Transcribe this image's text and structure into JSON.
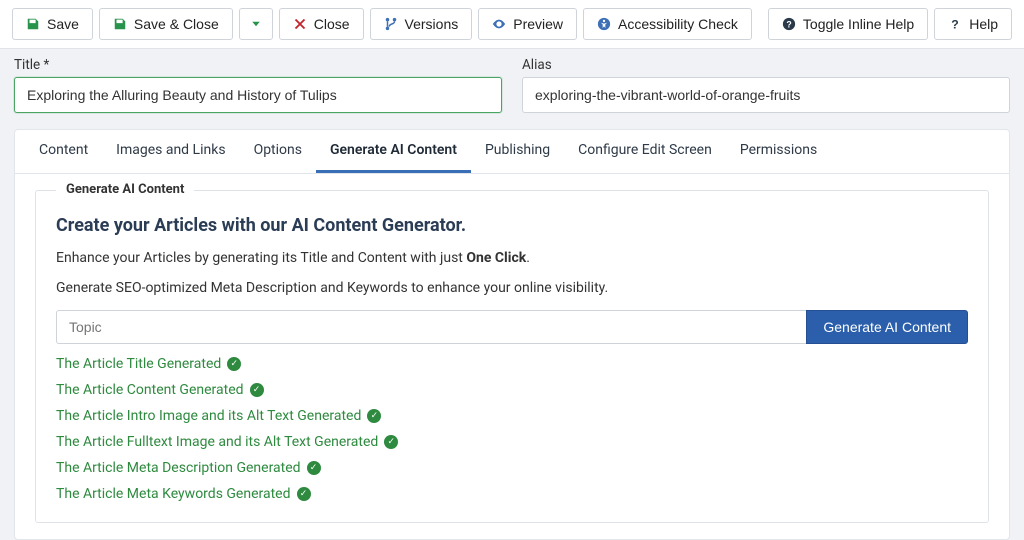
{
  "toolbar": {
    "save": "Save",
    "save_close": "Save & Close",
    "close": "Close",
    "versions": "Versions",
    "preview": "Preview",
    "accessibility": "Accessibility Check",
    "toggle_help": "Toggle Inline Help",
    "help": "Help"
  },
  "fields": {
    "title_label": "Title *",
    "title_value": "Exploring the Alluring Beauty and History of Tulips",
    "alias_label": "Alias",
    "alias_value": "exploring-the-vibrant-world-of-orange-fruits"
  },
  "tabs": [
    "Content",
    "Images and Links",
    "Options",
    "Generate AI Content",
    "Publishing",
    "Configure Edit Screen",
    "Permissions"
  ],
  "active_tab_index": 3,
  "panel": {
    "legend": "Generate AI Content",
    "headline": "Create your Articles with our AI Content Generator.",
    "desc1_a": "Enhance your Articles by generating its Title and Content with just ",
    "desc1_b": "One Click",
    "desc1_c": ".",
    "desc2": "Generate SEO-optimized Meta Description and Keywords to enhance your online visibility.",
    "topic_placeholder": "Topic",
    "generate_btn": "Generate AI Content",
    "statuses": [
      "The Article Title Generated",
      "The Article Content Generated",
      "The Article Intro Image and its Alt Text Generated",
      "The Article Fulltext Image and its Alt Text Generated",
      "The Article Meta Description Generated",
      "The Article Meta Keywords Generated"
    ]
  }
}
